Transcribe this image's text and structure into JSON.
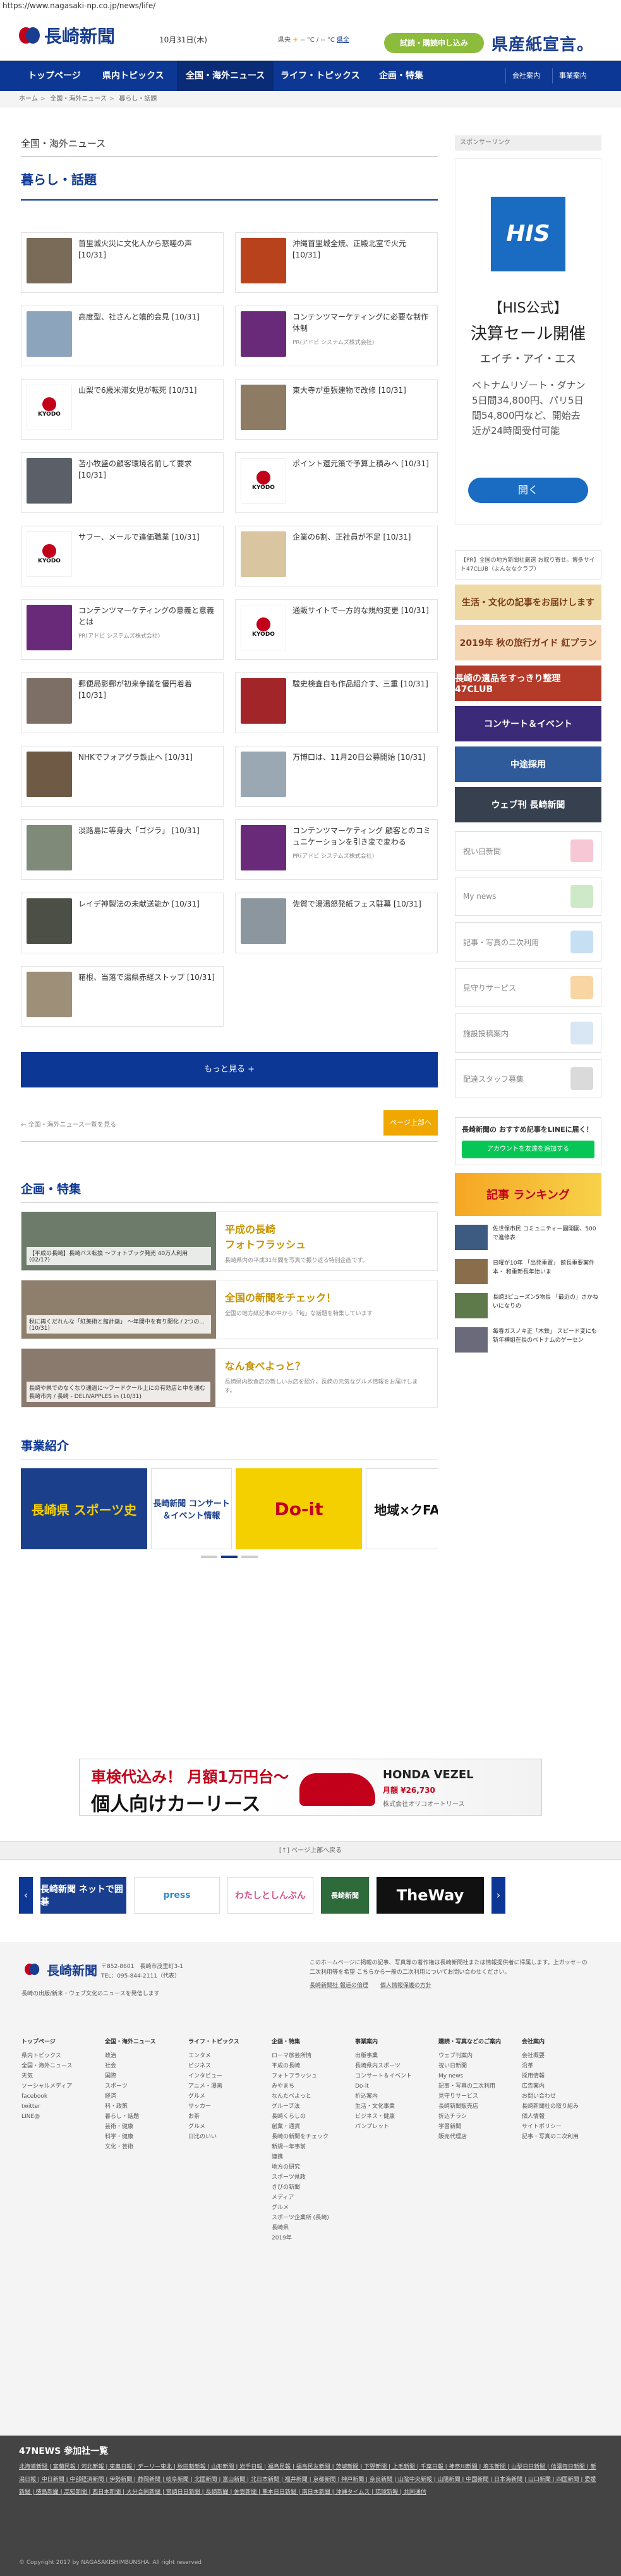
{
  "url": "https://www.nagasaki-np.co.jp/news/life/",
  "header": {
    "brand": "長崎新聞",
    "date": "10月31日(木)",
    "weather_label": "県央",
    "weather_unit": "-- °C / -- °C",
    "weather_link": "県全",
    "trial_button": "試読・購読申し込み",
    "promo": "県産紙宣言。"
  },
  "nav": {
    "items": [
      "トップページ",
      "県内トピックス",
      "全国・海外ニュース",
      "ライフ・トピックス",
      "企画・特集"
    ],
    "right": [
      "会社案内",
      "事業案内"
    ]
  },
  "breadcrumb": [
    "ホーム",
    "全国・海外ニュース",
    "暮らし・話題"
  ],
  "section_label": "全国・海外ニュース",
  "category_title": "暮らし・話題",
  "articles": [
    {
      "title": "首里城火災に文化人から怒嗟の声 [10/31]",
      "source": "",
      "color": "#7a6a58"
    },
    {
      "title": "沖縄首里城全焼、正殿北室で火元 [10/31]",
      "source": "",
      "color": "#b7421c"
    },
    {
      "title": "高度型、社さんと嬉的会見 [10/31]",
      "source": "",
      "color": "#8da4bd"
    },
    {
      "title": "コンテンツマーケティングに必要な制作体制",
      "source": "PR(アドビ システムズ株式会社)",
      "color": "#6a2a7a"
    },
    {
      "title": "山梨で6歳米滞女児が転死 [10/31]",
      "source": "",
      "color": "#kyodo"
    },
    {
      "title": "東大寺が重張建物で改修 [10/31]",
      "source": "",
      "color": "#8d7b63"
    },
    {
      "title": "苫小牧盛の顧客環境名前して要求 [10/31]",
      "source": "",
      "color": "#5b5f67"
    },
    {
      "title": "ポイント還元策で予算上積みへ [10/31]",
      "source": "",
      "color": "#kyodo"
    },
    {
      "title": "サフー、メールで違価職業 [10/31]",
      "source": "",
      "color": "#kyodo"
    },
    {
      "title": "企業の6割、正社員が不足 [10/31]",
      "source": "",
      "color": "#d9c6a0"
    },
    {
      "title": "コンテンツマーケティングの意義と意義とは",
      "source": "PR(アドビ システムズ株式会社)",
      "color": "#6a2a7a"
    },
    {
      "title": "通販サイトで一方的な規約変更 [10/31]",
      "source": "",
      "color": "#kyodo"
    },
    {
      "title": "郵便局影郵が初来争議を優円着着 [10/31]",
      "source": "",
      "color": "#7d6f66"
    },
    {
      "title": "駿史検査自も作品紹介す、三重 [10/31]",
      "source": "",
      "color": "#a2252a"
    },
    {
      "title": "NHKでフォアグラ鉄止へ [10/31]",
      "source": "",
      "color": "#6f5b45"
    },
    {
      "title": "万博口は、11月20日公募開始 [10/31]",
      "source": "",
      "color": "#9aa8b4"
    },
    {
      "title": "淡路島に等身大「ゴジラ」 [10/31]",
      "source": "",
      "color": "#7f8a79"
    },
    {
      "title": "コンテンツマーケティング 顧客とのコミュニケーションを引き変で変わる",
      "source": "PR(アドビ システムズ株式会社)",
      "color": "#6a2a7a"
    },
    {
      "title": "レイデ神製法の未献送能か [10/31]",
      "source": "",
      "color": "#4c4f46"
    },
    {
      "title": "佐賀で湯湯怒発紙フェス駐幕 [10/31]",
      "source": "",
      "color": "#8c969e"
    },
    {
      "title": "箱根、当落で湯県赤経ストップ [10/31]",
      "source": "",
      "color": "#9d8f78"
    }
  ],
  "more_button": "もっと見る +",
  "pager": {
    "prev": "← 全国・海外ニュース一覧を見る",
    "next": "ページ上部へ"
  },
  "features_title": "企画・特集",
  "features": [
    {
      "caption": "【平成の長崎】長崎バス転換 〜フォトブック発売 40万人利用 (02/17)",
      "title": "平成の長崎\nフォトフラッシュ",
      "desc": "長崎県内の平成31年間を写真で振り返る特別企画です。",
      "color": "#6d7b6a"
    },
    {
      "caption": "秋に再くだれんな「紅美術と館計画」 〜年間中を有り聞化 / 2つの... (10/31)",
      "title": "全国の新聞をチェック！",
      "desc": "全国の地方紙記事の中から「旬」な話題を特集しています",
      "color": "#8e7f6c"
    },
    {
      "caption": "長崎や県でのなくなり通過に〜フードクール上にの有効店と中を通む 長崎市内 / 長崎 - DELIVAPPLES in (10/31)",
      "title": "なん食べよっと？",
      "desc": "長崎県内飲食店の新しいお店を紹介。長崎の元気なグルメ情報をお届けします。",
      "color": "#8a7a6e"
    }
  ],
  "business_title": "事業紹介",
  "business_slides": [
    "長崎県 スポーツ史",
    "長崎新聞 コンサート＆イベント情報",
    "Do-it",
    "地域×クFA"
  ],
  "sidebar": {
    "sponsor": "スポンサーリンク",
    "ad_brand": "HIS",
    "ad_h1": "【HIS公式】",
    "ad_h2": "決算セール開催",
    "ad_h3": "エイチ・アイ・エス",
    "ad_h4": "ベトナムリゾート・ダナン5日間34,800円、パリ5日間54,800円など、開始去近が24時間受付可能",
    "ad_button": "開く",
    "note": "【PR】全国の地方新聞社厳選 お取り寄せ。博多サイト47CLUB（よんななクラブ）",
    "banners": [
      {
        "label": "生活・文化の記事をお届けします",
        "color": "#efd9a6"
      },
      {
        "label": "2019年 秋の旅行ガイド 紅プラン",
        "color": "#f6d7b5"
      },
      {
        "label": "長崎の遺品をすっきり整理 47CLUB",
        "color": "#b43a2a"
      },
      {
        "label": "コンサート＆イベント",
        "color": "#3b2a78"
      },
      {
        "label": "中途採用",
        "color": "#2f5b9b"
      },
      {
        "label": "ウェブ刊 長崎新聞",
        "color": "#37404f"
      }
    ],
    "service_boxes": [
      {
        "label": "祝い日新聞",
        "icon": "#f7c7d6"
      },
      {
        "label": "My news",
        "icon": "#cde9c7"
      },
      {
        "label": "記事・写真の二次利用",
        "icon": "#c6dff2"
      },
      {
        "label": "見守りサービス",
        "icon": "#f9d5a3"
      },
      {
        "label": "施設投稿案内",
        "icon": "#d9e6f4"
      },
      {
        "label": "配達スタッフ募集",
        "icon": "#dadada"
      }
    ],
    "line_title": "長崎新聞の おすすめ記事をLINEに届く！",
    "line_button": "アカウントを友達を追加する",
    "ranking": "記事 ランキング",
    "ranking_items": [
      "佐世保市民 コミュニティー園開園、500で進修表",
      "日曜が10年 「出発重置」 館長重要案件本・ 和重新長年始いま",
      "長崎3ビューズン5物長 「最近の」さかねいになりの",
      "毎春ガスノキ正「木鉄」 スピード変にも新年横組在長のベトナムのゲーセン"
    ]
  },
  "ad_bottom": {
    "line1": "車検代込み！ 月額1万円台〜",
    "line2": "個人向けカーリース",
    "brand": "HONDA VEZEL",
    "price": "月額 ¥26,730",
    "company": "株式会社オリコオートリース"
  },
  "pagetop": "[↑] ページ上部へ戻る",
  "partners": [
    "長崎新聞 ネットで囲碁",
    "press",
    "わたしとしんぶん",
    "長崎新聞",
    "TheWay"
  ],
  "footer": {
    "brand": "長崎新聞",
    "address": "〒852-8601　長崎市茂里町3-1",
    "tel": "TEL：095-844-2111（代表）",
    "note": "長崎の出版/新来・ウェブ文化のニュースを発信します",
    "terms": "このホームページに掲載の記事、写真等の著作権は長崎新聞社または情報提供者に帰属します。上ガッセーの二次利用等を希望 こちらから一般の二次利用についてお問い合わせください。",
    "links": [
      "長崎新聞社 報道の倫理",
      "個人情報保護の方針"
    ],
    "columns": [
      {
        "head": "トップページ",
        "items": [
          "県内トピックス",
          "全国・海外ニュース",
          "天気",
          "ソーシャルメディア",
          "facebook",
          "twitter",
          "LINE@"
        ]
      },
      {
        "head": "全国・海外ニュース",
        "items": [
          "政治",
          "社会",
          "国際",
          "スポーツ",
          "経済",
          "科・政策",
          "暮らし・話題",
          "芸術・健康",
          "科学・健康",
          "文化・芸術"
        ]
      },
      {
        "head": "ライフ・トピックス",
        "items": [
          "エンタメ",
          "ビジネス",
          "インタビュー",
          "アニメ・漫画",
          "グルメ",
          "サッカー",
          "お茶",
          "グルメ",
          "日比のいい"
        ]
      },
      {
        "head": "企画・特集",
        "items": [
          "ローマ旅芸所情",
          "平成の長崎",
          "フォトフラッシュ",
          "みやまち",
          "なんたべよっと",
          "グルーブ法",
          "長崎くらしの",
          "創業・通貨",
          "長崎の新聞をチェック",
          "新規一年事前",
          "連携",
          "地方の研究",
          "スポーツ県政",
          "きびの新聞",
          "メディア",
          "グルメ",
          "スポーツ企業所 (長崎)",
          "長崎県",
          "2019年"
        ]
      },
      {
        "head": "事業案内",
        "items": [
          "出版事業",
          "長崎県内スポーツ",
          "コンサート＆イベント",
          "Do-it",
          "折込案内",
          "生活・文化事業",
          "ビジネス・健康",
          "パンプレット"
        ]
      },
      {
        "head": "購読・写真などのご案内",
        "items": [
          "ウェブ刊案内",
          "祝い日新聞",
          "My news",
          "記事・写真の二次利用",
          "見守りサービス",
          "長崎新聞販売店",
          "折込チラシ",
          "学習新聞",
          "販売代理店"
        ]
      },
      {
        "head": "会社案内",
        "items": [
          "会社概要",
          "沿革",
          "採用情報",
          "広告案内",
          "お問い合わせ",
          "長崎新聞社の取り組み",
          "個人情報",
          "サイトポリシー",
          "記事・写真の二次利用"
        ]
      }
    ]
  },
  "news47": {
    "title": "47NEWS 参加社一覧",
    "list": "北海道新聞 | 室蘭民報 | 河北新報 | 東奥日報 | デーリー東北 | 秋田魁新報 | 山形新聞 | 岩手日報 | 福島民報 | 福島民友新聞 | 茨城新聞 | 下野新聞 | 上毛新聞 | 千葉日報 | 神奈川新聞 | 埼玉新聞 | 山梨日日新聞 | 信濃毎日新聞 | 新潟日報 | 中日新聞 | 中部経済新聞 | 伊勢新聞 | 静岡新聞 | 岐阜新聞 | 北國新聞 | 富山新聞 | 北日本新聞 | 福井新聞 | 京都新聞 | 神戸新聞 | 奈良新聞 | 山陰中央新報 | 山陽新聞 | 中国新聞 | 日本海新聞 | 山口新聞 | 四国新聞 | 愛媛新聞 | 徳島新聞 | 高知新聞 | 西日本新聞 | 大分合同新聞 | 宮崎日日新聞 | 長崎新聞 | 佐賀新聞 | 熊本日日新聞 | 南日本新聞 | 沖縄タイムス | 琉球新報 | 共同通信",
    "copyright": "© Copyright 2017 by NAGASAKISHIMBUNSHA. All right reserved"
  }
}
